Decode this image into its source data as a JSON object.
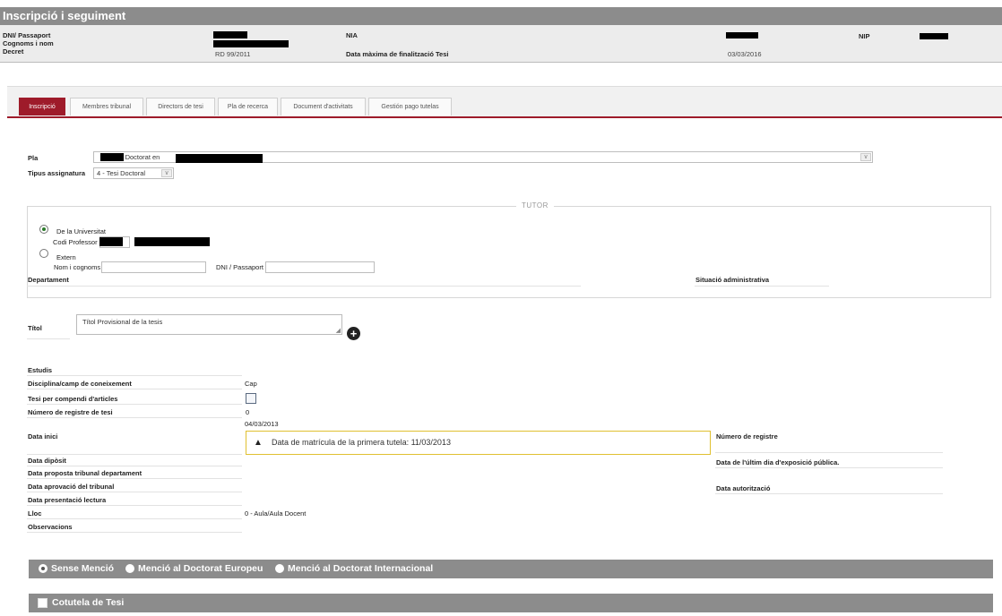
{
  "header": {
    "title": "Inscripció i seguiment"
  },
  "info": {
    "dni_label": "DNI/ Passaport",
    "name_label": "Cognoms i nom",
    "decret_label": "Decret",
    "decret_value": "RD 99/2011",
    "nia_label": "NIA",
    "data_max_label": "Data màxima de finalització Tesi",
    "data_max_value": "03/03/2016",
    "nip_label": "NIP"
  },
  "tabs": [
    {
      "label": "Inscripció",
      "active": true
    },
    {
      "label": "Membres tribunal"
    },
    {
      "label": "Directors de tesi"
    },
    {
      "label": "Pla de recerca"
    },
    {
      "label": "Document d'activitats"
    },
    {
      "label": "Gestión pago tutelas"
    }
  ],
  "form": {
    "pla_label": "Pla",
    "pla_value": "- Doctorat en",
    "tipus_label": "Tipus assignatura",
    "tipus_value": "4 - Tesi Doctoral"
  },
  "tutor": {
    "legend": "TUTOR",
    "universitat_label": "De la Universitat",
    "codi_label": "Codi Professor",
    "extern_label": "Extern",
    "nom_label": "Nom i cognoms",
    "dni_label": "DNI / Passaport",
    "departament_label": "Departament",
    "situacio_label": "Situació administrativa"
  },
  "titol": {
    "label": "Títol",
    "value": "Títol Provisional de la tesis"
  },
  "details": {
    "estudis_label": "Estudis",
    "disciplina_label": "Disciplina/camp de coneixement",
    "disciplina_value": "Cap",
    "compendi_label": "Tesi per compendi d'articles",
    "num_registre_tesi_label": "Número de registre de tesi",
    "num_registre_tesi_value": "0",
    "data_inici_value": "04/03/2013",
    "data_inici_label": "Data inici",
    "alert_text": "Data de matrícula de la primera tutela:  11/03/2013",
    "num_registre_label": "Número de registre",
    "data_diposit_label": "Data dipòsit",
    "data_ultim_dia_label": "Data de l'últim dia d'exposició pública.",
    "data_proposta_label": "Data proposta tribunal departament",
    "data_aprovacio_label": "Data aprovació del tribunal",
    "data_autoritzacio_label": "Data autorització",
    "data_presentacio_label": "Data presentació lectura",
    "lloc_label": "Lloc",
    "lloc_value": "0 - Aula/Aula Docent",
    "observacions_label": "Observacions"
  },
  "mencio": {
    "sense": "Sense Menció",
    "europeu": "Menció al Doctorat Europeu",
    "internacional": "Menció al Doctorat Internacional"
  },
  "cotutela": {
    "label": "Cotutela de Tesi"
  },
  "colors": {
    "accent": "#9e1b2a",
    "bar": "#8c8c8c",
    "alert_border": "#e0c030"
  }
}
